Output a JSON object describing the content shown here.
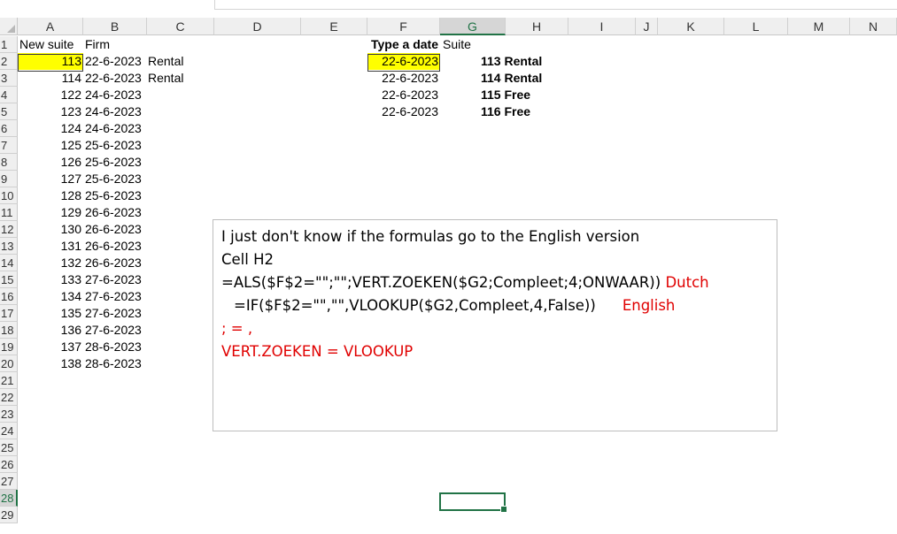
{
  "columns": [
    "A",
    "B",
    "C",
    "D",
    "E",
    "F",
    "G",
    "H",
    "I",
    "J",
    "K",
    "L",
    "M",
    "N"
  ],
  "active_column": "G",
  "rows": [
    "1",
    "2",
    "3",
    "4",
    "5",
    "6",
    "7",
    "8",
    "9",
    "10",
    "11",
    "12",
    "13",
    "14",
    "15",
    "16",
    "17",
    "18",
    "19",
    "20",
    "21",
    "22",
    "23",
    "24",
    "25",
    "26",
    "27",
    "28",
    "29"
  ],
  "active_row": "28",
  "headers": {
    "a1": "New suite",
    "b1": "Firm",
    "f1": "Type a date",
    "g1": "Suite"
  },
  "col_a": [
    "113",
    "114",
    "122",
    "123",
    "124",
    "125",
    "126",
    "127",
    "128",
    "129",
    "130",
    "131",
    "132",
    "133",
    "134",
    "135",
    "136",
    "137",
    "138"
  ],
  "col_b": [
    "22-6-2023",
    "22-6-2023",
    "24-6-2023",
    "24-6-2023",
    "24-6-2023",
    "25-6-2023",
    "25-6-2023",
    "25-6-2023",
    "25-6-2023",
    "26-6-2023",
    "26-6-2023",
    "26-6-2023",
    "26-6-2023",
    "27-6-2023",
    "27-6-2023",
    "27-6-2023",
    "27-6-2023",
    "28-6-2023",
    "28-6-2023"
  ],
  "col_c": [
    "Rental",
    "Rental"
  ],
  "col_f": [
    "22-6-2023",
    "22-6-2023",
    "22-6-2023",
    "22-6-2023"
  ],
  "col_gh": [
    "113 Rental",
    "114 Rental",
    "115 Free",
    "116 Free"
  ],
  "textbox": {
    "line1": "I just don't know if the formulas go to the English version",
    "line2": "Cell H2",
    "line3_formula": "=ALS($F$2=\"\";\"\";VERT.ZOEKEN($G2;Compleet;4;ONWAAR))",
    "line3_lang": "Dutch",
    "line4_formula": "=IF($F$2=\"\",\"\",VLOOKUP($G2,Compleet,4,False))",
    "line4_lang": "English",
    "line5": "; = ,",
    "line6": "VERT.ZOEKEN = VLOOKUP"
  },
  "colors": {
    "highlight": "#ffff00",
    "accent": "#217346",
    "note": "#e00000"
  }
}
